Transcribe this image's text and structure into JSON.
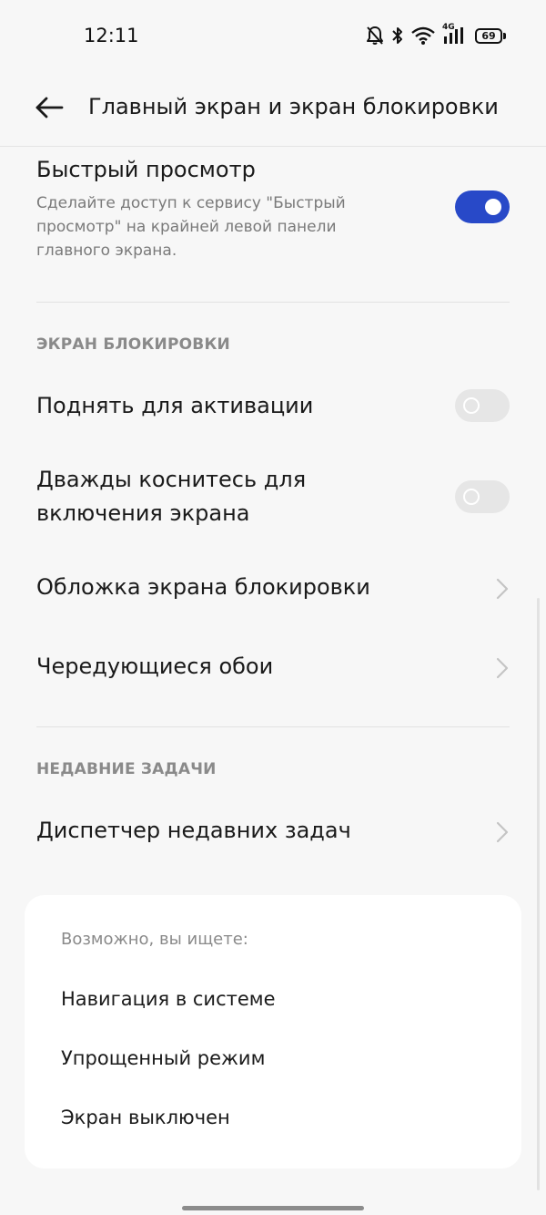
{
  "status_bar": {
    "time": "12:11",
    "network": "4G",
    "battery": "69"
  },
  "header": {
    "title": "Главный экран и экран блокировки"
  },
  "quick_view": {
    "title": "Быстрый просмотр",
    "subtitle": "Сделайте доступ к сервису \"Быстрый просмотр\" на крайней левой панели главного экрана.",
    "enabled": true
  },
  "lock_screen": {
    "section_title": "ЭКРАН БЛОКИРОВКИ",
    "raise_to_wake": {
      "label": "Поднять для активации",
      "enabled": false
    },
    "double_tap": {
      "label": "Дважды коснитесь для включения экрана",
      "enabled": false
    },
    "cover_label": "Обложка экрана блокировки",
    "rotating_wallpapers_label": "Чередующиеся обои"
  },
  "recent_tasks": {
    "section_title": "НЕДАВНИЕ ЗАДАЧИ",
    "manager_label": "Диспетчер недавних задач"
  },
  "suggestions": {
    "label": "Возможно, вы ищете:",
    "items": [
      "Навигация в системе",
      "Упрощенный режим",
      "Экран выключен"
    ]
  },
  "colors": {
    "accent": "#2849c8",
    "background": "#f7f7f7",
    "card": "#ffffff"
  }
}
